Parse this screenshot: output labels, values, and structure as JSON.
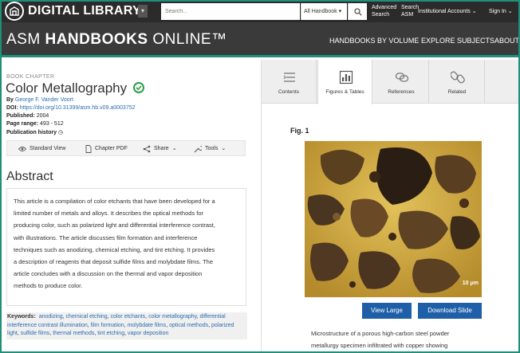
{
  "header": {
    "logo_letter": "⌂",
    "logo_text": "DIGITAL LIBRARY",
    "search_placeholder": "Search...",
    "search_scope": "All Handbook",
    "advanced_search": [
      "Advanced",
      "Search"
    ],
    "search_asm": [
      "Search",
      "ASM"
    ],
    "institutional_accounts": "Institutional Accounts",
    "sign_in": "Sign In"
  },
  "brandbar": {
    "brand_light": "ASM",
    "brand_bold": "HANDBOOKS",
    "brand_rest": "ONLINE™",
    "nav": [
      "HANDBOOKS BY VOLUME",
      "EXPLORE SUBJECTS",
      "ABOUT"
    ]
  },
  "chapter": {
    "kind": "BOOK CHAPTER",
    "title": "Color Metallography",
    "by_label": "By",
    "author": "George F. Vander Voort",
    "doi_label": "DOI:",
    "doi": "https://doi.org/10.31399/asm.hb.v09.a0003752",
    "published_label": "Published:",
    "published": "2004",
    "page_range_label": "Page range:",
    "page_range": "493 - 512",
    "publication_history": "Publication history"
  },
  "toolbar": {
    "standard_view": "Standard View",
    "chapter_pdf": "Chapter PDF",
    "share": "Share",
    "tools": "Tools"
  },
  "abstract": {
    "heading": "Abstract",
    "lines": [
      "This article is a compilation of color etchants that have been developed for a",
      "limited number of metals and alloys. It describes the optical methods for",
      "producing color, such as polarized light and differential interference contrast,",
      "with illustrations. The article discusses film formation and interference",
      "techniques such as anodizing, chemical etching, and tint etching. It provides",
      "a description of reagents that deposit sulfide films and molybdate films. The",
      "article concludes with a discussion on the thermal and vapor deposition",
      "methods to produce color."
    ]
  },
  "keywords": {
    "label": "Keywords:",
    "items": [
      "anodizing",
      "chemical etching",
      "color etchants",
      "color metallography",
      "differential interference contrast illumination",
      "film formation",
      "molybdate films",
      "optical methods",
      "polarized light",
      "sulfide films",
      "thermal methods",
      "tint etching",
      "vapor deposition"
    ]
  },
  "tabs": [
    {
      "label": "Contents",
      "icon": "list-icon"
    },
    {
      "label": "Figures & Tables",
      "icon": "chart-icon"
    },
    {
      "label": "References",
      "icon": "chain-icon"
    },
    {
      "label": "Related",
      "icon": "link-icon"
    }
  ],
  "figure": {
    "label": "Fig. 1",
    "scale_text": "10 μm",
    "view_large": "View Large",
    "download_slide": "Download Slide",
    "caption_lines": [
      "Microstructure of a porous high-carbon steel powder",
      "metallurgy specimen infiltrated with copper showing"
    ]
  },
  "colors": {
    "teal": "#1f8f7a",
    "dark": "#2b2b2b",
    "link": "#2b6cb0",
    "button": "#1f5fa8"
  }
}
